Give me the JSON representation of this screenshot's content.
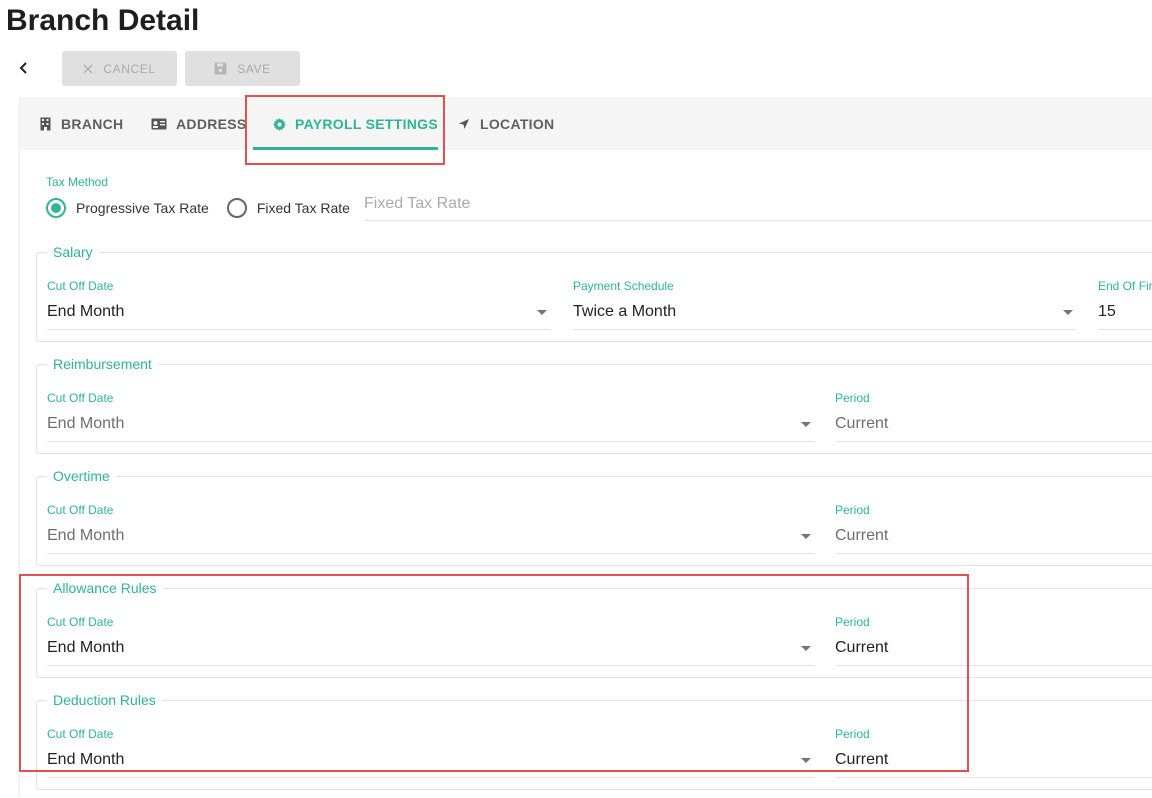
{
  "page": {
    "title": "Branch Detail"
  },
  "toolbar": {
    "cancel_label": "CANCEL",
    "save_label": "SAVE"
  },
  "tabs": [
    {
      "label": "BRANCH",
      "icon": "building-icon",
      "active": false
    },
    {
      "label": "ADDRESS",
      "icon": "id-card-icon",
      "active": false
    },
    {
      "label": "PAYROLL SETTINGS",
      "icon": "gear-icon",
      "active": true
    },
    {
      "label": "LOCATION",
      "icon": "location-arrow-icon",
      "active": false
    }
  ],
  "tax": {
    "label": "Tax Method",
    "options": [
      {
        "label": "Progressive Tax Rate",
        "selected": true
      },
      {
        "label": "Fixed Tax Rate",
        "selected": false
      }
    ],
    "fixed_rate_placeholder": "Fixed Tax Rate"
  },
  "salary": {
    "title": "Salary",
    "cutoff_label": "Cut Off Date",
    "cutoff_value": "End Month",
    "schedule_label": "Payment Schedule",
    "schedule_value": "Twice a Month",
    "end_first_label": "End Of Fir",
    "end_first_value": "15"
  },
  "reimbursement": {
    "title": "Reimbursement",
    "cutoff_label": "Cut Off Date",
    "cutoff_value": "End Month",
    "period_label": "Period",
    "period_value": "Current"
  },
  "overtime": {
    "title": "Overtime",
    "cutoff_label": "Cut Off Date",
    "cutoff_value": "End Month",
    "period_label": "Period",
    "period_value": "Current"
  },
  "allowance": {
    "title": "Allowance Rules",
    "cutoff_label": "Cut Off Date",
    "cutoff_value": "End Month",
    "period_label": "Period",
    "period_value": "Current"
  },
  "deduction": {
    "title": "Deduction Rules",
    "cutoff_label": "Cut Off Date",
    "cutoff_value": "End Month",
    "period_label": "Period",
    "period_value": "Current"
  },
  "colors": {
    "accent": "#2fb495",
    "highlight": "#e25050",
    "disabled": "#e0e0e0"
  }
}
